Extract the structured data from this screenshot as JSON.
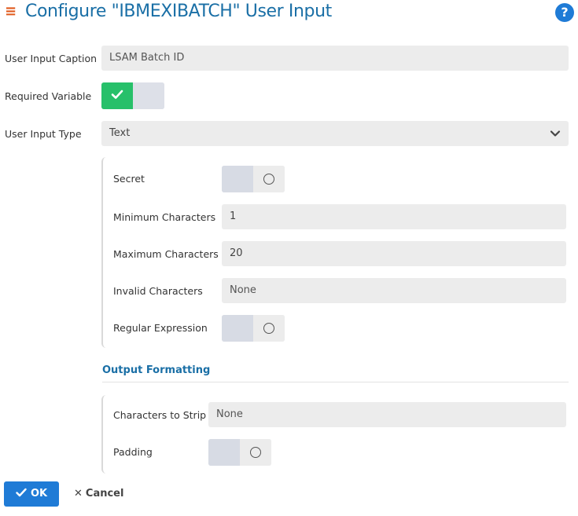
{
  "header": {
    "title": "Configure \"IBMEXIBATCH\" User Input",
    "menu_icon": "hamburger-menu-icon",
    "help_icon": "?"
  },
  "form": {
    "caption_label": "User Input Caption",
    "caption_value": "LSAM Batch ID",
    "required_label": "Required Variable",
    "required_on": true,
    "type_label": "User Input Type",
    "type_value": "Text"
  },
  "text_options": {
    "secret_label": "Secret",
    "secret_on": false,
    "min_label": "Minimum Characters",
    "min_value": "1",
    "max_label": "Maximum Characters",
    "max_value": "20",
    "invalid_label": "Invalid Characters",
    "invalid_placeholder": "None",
    "regex_label": "Regular Expression",
    "regex_on": false
  },
  "output_formatting": {
    "title": "Output Formatting",
    "strip_label": "Characters to Strip",
    "strip_placeholder": "None",
    "padding_label": "Padding",
    "padding_on": false
  },
  "actions": {
    "ok_label": "OK",
    "cancel_label": "Cancel"
  },
  "colors": {
    "accent": "#1f7bd6",
    "title": "#1a6fa6",
    "toggle_on": "#27c06a",
    "menu_icon": "#e05a1c"
  }
}
